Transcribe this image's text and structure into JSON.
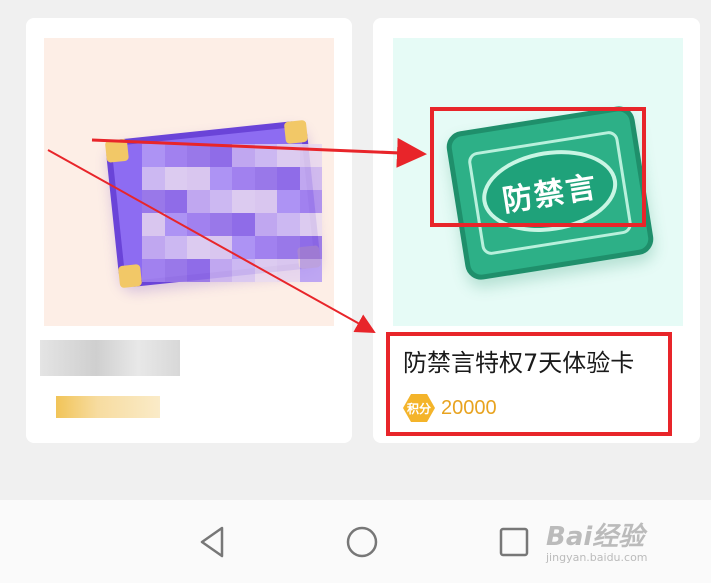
{
  "products": [
    {
      "name": "",
      "points": "",
      "image_icon": "blurred-purple-card"
    },
    {
      "name": "防禁言特权7天体验卡",
      "points_badge": "积分",
      "points": "20000",
      "image_icon": "anti-mute-card",
      "image_text": "防禁言"
    }
  ],
  "navigation": {
    "back_icon": "triangle-back-icon",
    "home_icon": "circle-home-icon",
    "recent_icon": "square-recent-icon"
  },
  "watermark": {
    "brand": "Bai经验",
    "url": "jingyan.baidu.com"
  },
  "colors": {
    "annotation_red": "#e8252a",
    "points_gold": "#e8a320",
    "card_green": "#2db087",
    "card_purple": "#8d6cf2"
  }
}
